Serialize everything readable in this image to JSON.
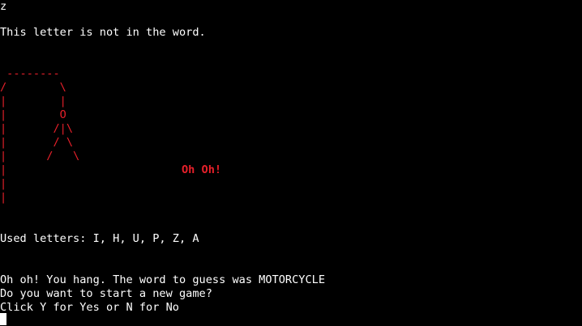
{
  "terminal": {
    "input_echo": "z",
    "feedback": "This letter is not in the word.",
    "hangman_art": [
      " --------",
      "/        \\",
      "|        |",
      "|        O",
      "|       /|\\",
      "|       / \\",
      "|      /   \\",
      "|",
      "|",
      "|"
    ],
    "exclamation": "Oh Oh!",
    "used_letters": "Used letters: I, H, U, P, Z, A",
    "result": "Oh oh! You hang. The word to guess was MOTORCYCLE",
    "prompt": "Do you want to start a new game?",
    "instructions": "Click Y for Yes or N for No"
  },
  "colors": {
    "background": "#000000",
    "text": "#ffffff",
    "accent": "#e8202a"
  }
}
